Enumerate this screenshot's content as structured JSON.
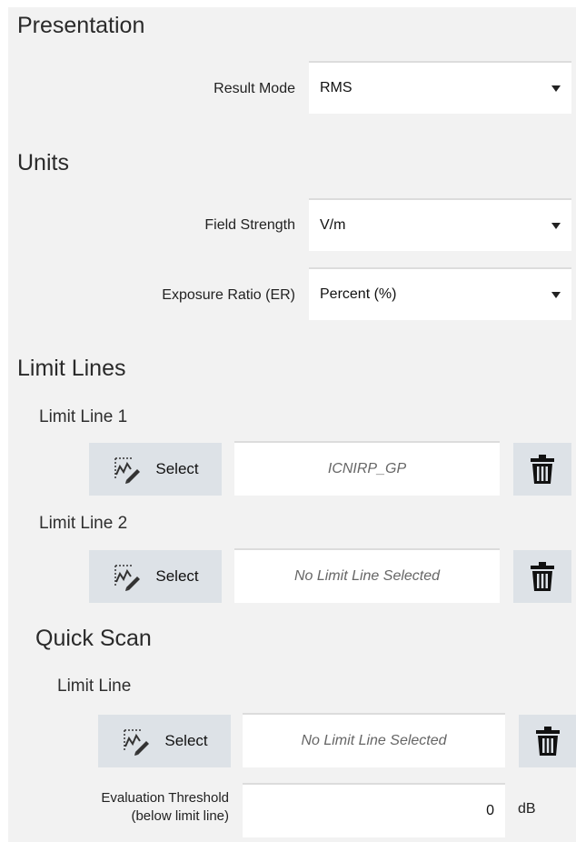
{
  "presentation": {
    "title": "Presentation",
    "result_mode": {
      "label": "Result Mode",
      "value": "RMS"
    }
  },
  "units": {
    "title": "Units",
    "field_strength": {
      "label": "Field Strength",
      "value": "V/m"
    },
    "exposure_ratio": {
      "label": "Exposure Ratio (ER)",
      "value": "Percent (%)"
    }
  },
  "limit_lines": {
    "title": "Limit Lines",
    "line1": {
      "label": "Limit Line 1",
      "select_label": "Select",
      "value": "ICNIRP_GP"
    },
    "line2": {
      "label": "Limit Line 2",
      "select_label": "Select",
      "value": "No Limit Line Selected"
    }
  },
  "quick_scan": {
    "title": "Quick Scan",
    "limit_line": {
      "label": "Limit Line",
      "select_label": "Select",
      "value": "No Limit Line Selected"
    },
    "threshold": {
      "label_line1": "Evaluation Threshold",
      "label_line2": "(below limit line)",
      "value": "0",
      "unit": "dB"
    }
  },
  "icons": {
    "select": "select-line-icon",
    "delete": "trash-icon",
    "dropdown": "chevron-down-icon"
  }
}
